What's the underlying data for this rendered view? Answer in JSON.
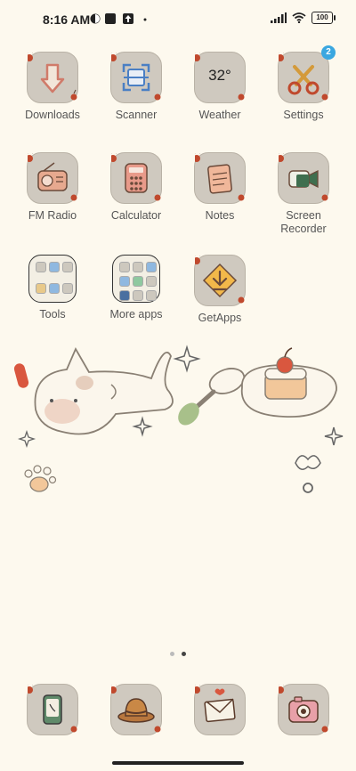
{
  "status_bar": {
    "time": "8:16 AM",
    "battery": "100",
    "icons": [
      "notification-dot-icon",
      "app-square-icon",
      "upload-icon",
      "signal-icon",
      "wifi-icon",
      "battery-icon"
    ]
  },
  "apps": [
    {
      "label": "Downloads",
      "icon": "download-arrow-icon"
    },
    {
      "label": "Scanner",
      "icon": "scan-frame-icon"
    },
    {
      "label": "Weather",
      "icon": "weather-icon",
      "temp": "32°"
    },
    {
      "label": "Settings",
      "icon": "scissors-icon",
      "badge": "2"
    },
    {
      "label": "FM Radio",
      "icon": "radio-icon"
    },
    {
      "label": "Calculator",
      "icon": "calculator-icon"
    },
    {
      "label": "Notes",
      "icon": "notepad-icon"
    },
    {
      "label": "Screen Recorder",
      "icon": "video-camera-icon"
    },
    {
      "label": "Tools",
      "icon": "folder-icon"
    },
    {
      "label": "More apps",
      "icon": "folder-icon"
    },
    {
      "label": "GetApps",
      "icon": "download-diamond-icon"
    }
  ],
  "dock": [
    {
      "icon": "phone-icon"
    },
    {
      "icon": "hat-icon"
    },
    {
      "icon": "envelope-icon"
    },
    {
      "icon": "camera-icon"
    }
  ],
  "colors": {
    "background": "#fdf9ee",
    "tile": "#cfc9bf",
    "badge": "#3aa7e0",
    "cherry": "#c0492d"
  }
}
